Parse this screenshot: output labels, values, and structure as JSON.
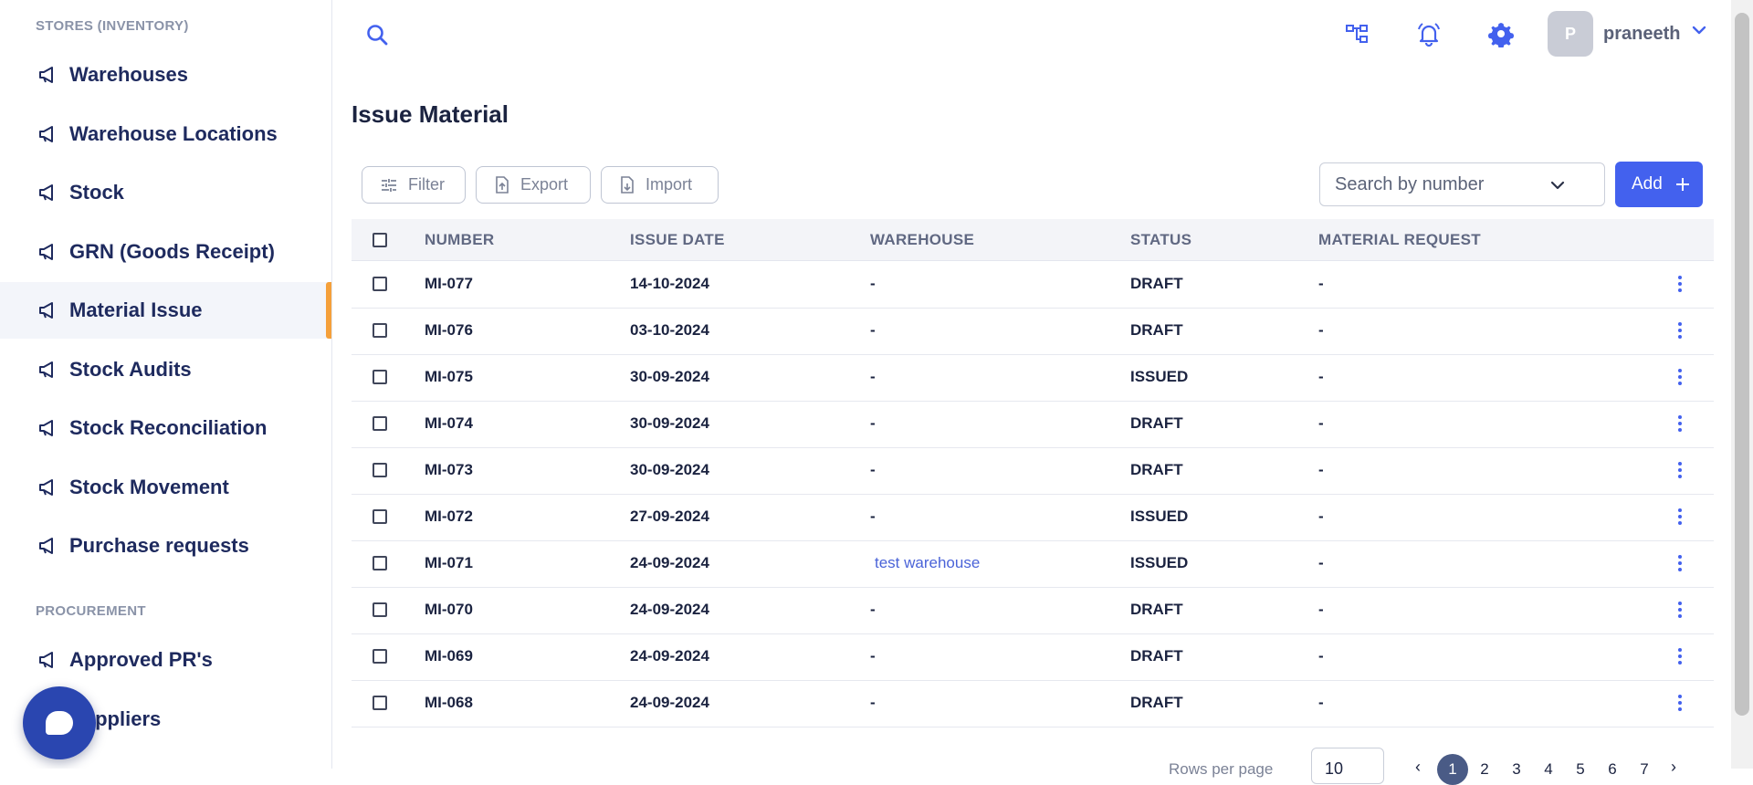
{
  "sidebar": {
    "section_inventory": "STORES (INVENTORY)",
    "items": [
      {
        "label": "Warehouses"
      },
      {
        "label": "Warehouse Locations"
      },
      {
        "label": "Stock"
      },
      {
        "label": "GRN (Goods Receipt)"
      },
      {
        "label": "Material Issue"
      },
      {
        "label": "Stock Audits"
      },
      {
        "label": "Stock Reconciliation"
      },
      {
        "label": "Stock Movement"
      },
      {
        "label": "Purchase requests"
      }
    ],
    "section_procurement": "PROCUREMENT",
    "procurement_items": [
      {
        "label": "Approved PR's"
      },
      {
        "label": "Suppliers"
      }
    ],
    "active_item": "Material Issue",
    "nav_icon": "megaphone-icon"
  },
  "topbar": {
    "avatar_initial": "P",
    "username": "praneeth",
    "icons": [
      "search-icon",
      "org-chart-icon",
      "bell-icon",
      "gear-icon",
      "chevron-down-icon"
    ]
  },
  "page": {
    "title": "Issue Material",
    "toolbar": {
      "filter_label": "Filter",
      "export_label": "Export",
      "import_label": "Import",
      "search_placeholder": "Search by number",
      "add_label": "Add"
    }
  },
  "table": {
    "headers": {
      "number": "NUMBER",
      "issue_date": "ISSUE DATE",
      "warehouse": "WAREHOUSE",
      "status": "STATUS",
      "material_request": "MATERIAL REQUEST"
    },
    "rows": [
      {
        "number": "MI-077",
        "issue_date": "14-10-2024",
        "warehouse": "-",
        "status": "DRAFT",
        "material_request": "-"
      },
      {
        "number": "MI-076",
        "issue_date": "03-10-2024",
        "warehouse": "-",
        "status": "DRAFT",
        "material_request": "-"
      },
      {
        "number": "MI-075",
        "issue_date": "30-09-2024",
        "warehouse": "-",
        "status": "ISSUED",
        "material_request": "-"
      },
      {
        "number": "MI-074",
        "issue_date": "30-09-2024",
        "warehouse": "-",
        "status": "DRAFT",
        "material_request": "-"
      },
      {
        "number": "MI-073",
        "issue_date": "30-09-2024",
        "warehouse": "-",
        "status": "DRAFT",
        "material_request": "-"
      },
      {
        "number": "MI-072",
        "issue_date": "27-09-2024",
        "warehouse": "-",
        "status": "ISSUED",
        "material_request": "-"
      },
      {
        "number": "MI-071",
        "issue_date": "24-09-2024",
        "warehouse": "test warehouse",
        "status": "ISSUED",
        "material_request": "-"
      },
      {
        "number": "MI-070",
        "issue_date": "24-09-2024",
        "warehouse": "-",
        "status": "DRAFT",
        "material_request": "-"
      },
      {
        "number": "MI-069",
        "issue_date": "24-09-2024",
        "warehouse": "-",
        "status": "DRAFT",
        "material_request": "-"
      },
      {
        "number": "MI-068",
        "issue_date": "24-09-2024",
        "warehouse": "-",
        "status": "DRAFT",
        "material_request": "-"
      }
    ]
  },
  "pagination": {
    "rows_per_page_label": "Rows per page",
    "rows_per_page_value": "10",
    "pages": [
      "1",
      "2",
      "3",
      "4",
      "5",
      "6",
      "7"
    ],
    "current_page": "1",
    "prev": "‹",
    "next": "›"
  },
  "colors": {
    "accent": "#4361ee",
    "sidebar_text": "#1e2a5e",
    "active_indicator": "#f5a03a",
    "chat_bubble": "#2a46b0"
  }
}
